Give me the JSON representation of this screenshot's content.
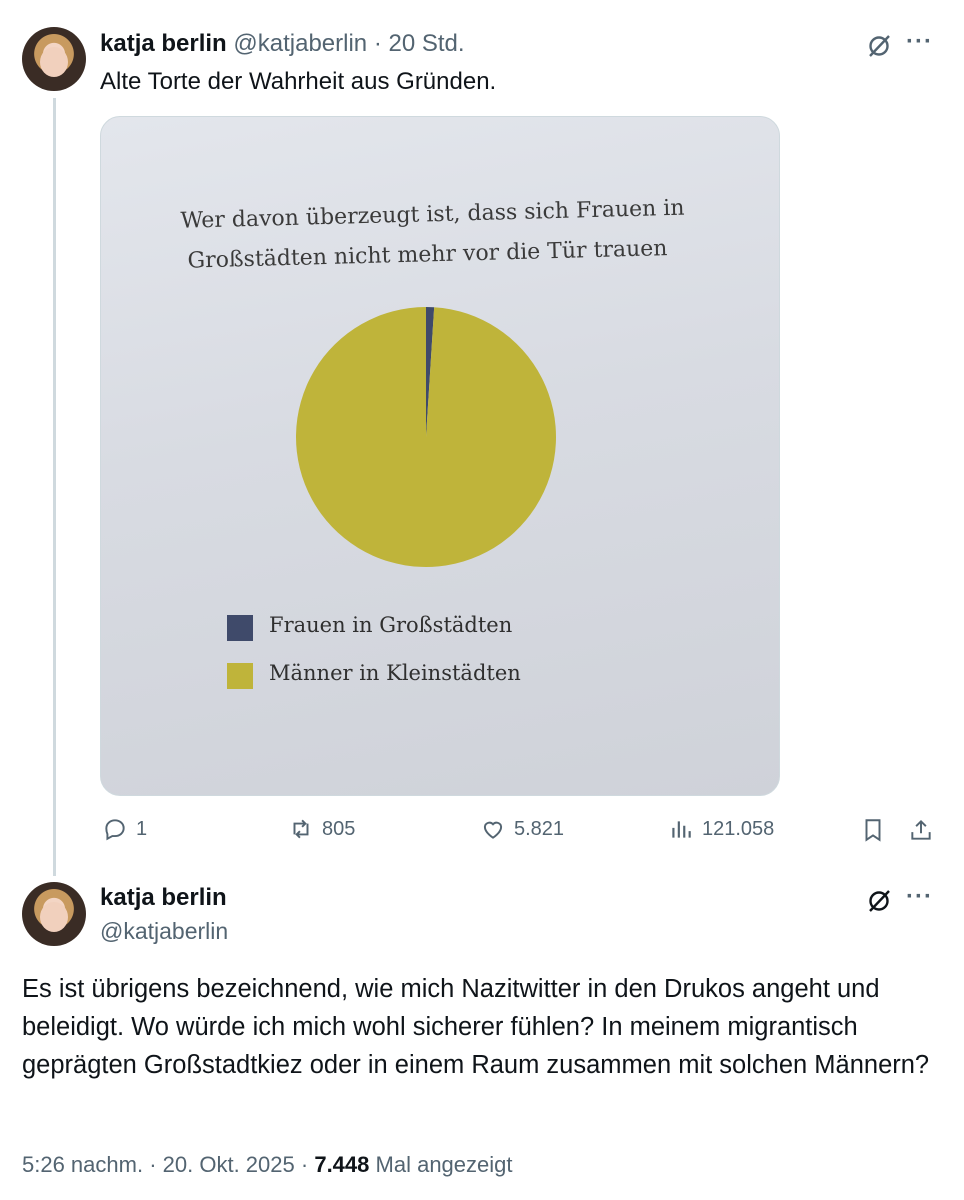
{
  "tweet1": {
    "author_name": "katja berlin",
    "handle": "@katjaberlin",
    "time": "20 Std.",
    "text": "Alte Torte der Wahrheit aus Gründen.",
    "media": {
      "title_line1": "Wer davon überzeugt ist, dass sich Frauen in",
      "title_line2": "Großstädten nicht mehr vor die Tür trauen",
      "chart_data": {
        "type": "pie",
        "title": "Wer davon überzeugt ist, dass sich Frauen in Großstädten nicht mehr vor die Tür trauen",
        "categories": [
          "Frauen in Großstädten",
          "Männer in Kleinstädten"
        ],
        "values": [
          1,
          99
        ],
        "colors": [
          "#3f4a6a",
          "#bfb43a"
        ],
        "legend": "bottom-left"
      }
    },
    "actions": {
      "replies": "1",
      "reposts": "805",
      "likes": "5.821",
      "views": "121.058"
    }
  },
  "tweet2": {
    "author_name": "katja berlin",
    "handle": "@katjaberlin",
    "text": "Es ist übrigens bezeichnend, wie mich Nazitwitter in den Drukos angeht und beleidigt. Wo würde ich mich wohl sicherer fühlen? In meinem migrantisch geprägten Großstadtkiez oder in einem Raum zusammen mit solchen Männern?",
    "time": "5:26 nachm.",
    "date": "20. Okt. 2025",
    "views_count": "7.448",
    "views_label": "Mal angezeigt"
  },
  "icons": {
    "reply": "reply-icon",
    "repost": "repost-icon",
    "like": "heart-icon",
    "views": "views-icon",
    "bookmark": "bookmark-icon",
    "share": "share-icon",
    "grok": "grok-icon",
    "more": "more-icon"
  },
  "colors": {
    "muted": "#536471",
    "text": "#0f1419",
    "thread_line": "#cfd9de"
  }
}
